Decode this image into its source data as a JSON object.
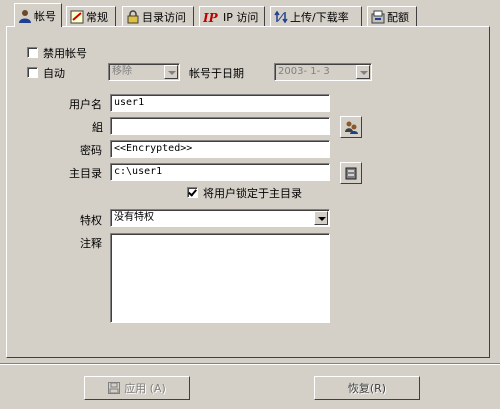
{
  "tabs": [
    {
      "label": "帐号",
      "icon": "user-icon"
    },
    {
      "label": "常规",
      "icon": "general-icon"
    },
    {
      "label": "目录访问",
      "icon": "lock-icon"
    },
    {
      "label": "IP 访问",
      "icon": "ip-icon"
    },
    {
      "label": "上传/下载率",
      "icon": "transfer-icon"
    },
    {
      "label": "配额",
      "icon": "quota-icon"
    }
  ],
  "account": {
    "disable_label": "禁用帐号",
    "disable_checked": false,
    "auto_label": "自动",
    "auto_checked": false,
    "auto_action": "移除",
    "expire_label": "帐号于日期",
    "expire_date": "2003- 1- 3",
    "username_label": "用户名",
    "username": "user1",
    "group_label": "組",
    "group": "",
    "password_label": "密码",
    "password": "<<Encrypted>>",
    "homedir_label": "主目录",
    "homedir": "c:\\user1",
    "lock_label": "将用户锁定于主目录",
    "lock_checked": true,
    "privilege_label": "特权",
    "privilege": "没有特权",
    "notes_label": "注释",
    "notes": ""
  },
  "buttons": {
    "apply": "应用 (A)",
    "restore": "恢复(R)"
  }
}
